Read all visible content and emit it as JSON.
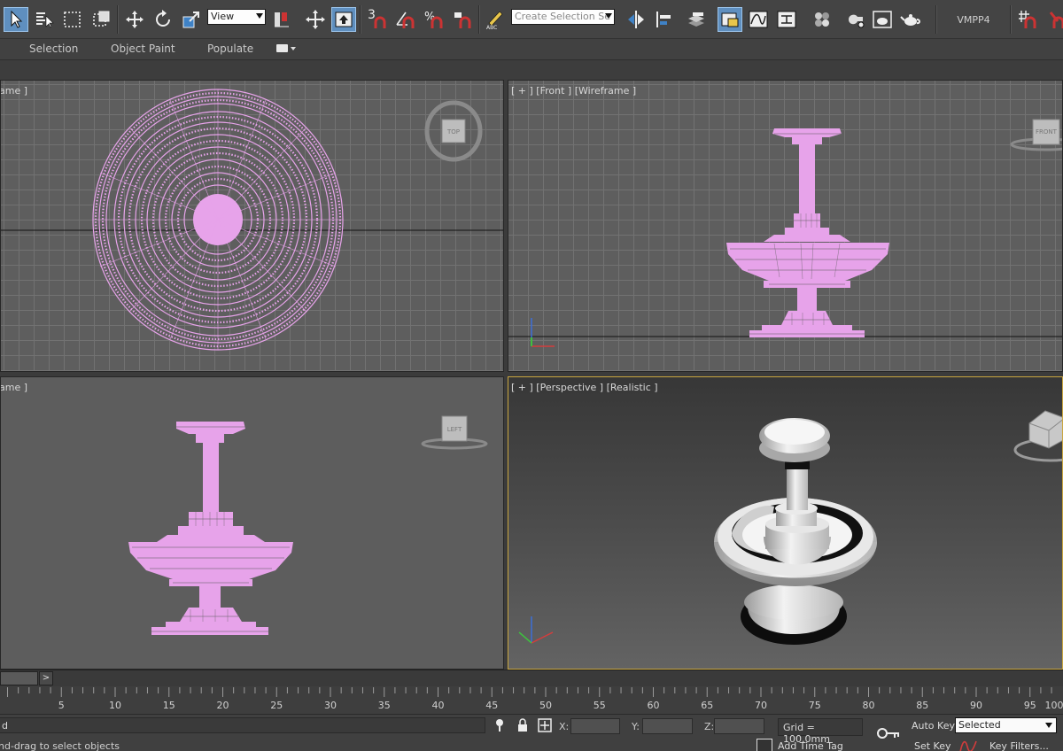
{
  "toolbar": {
    "reference_coord": "View",
    "named_selection": "Create Selection Se",
    "snap_3": "3",
    "workspace": "VMPP4"
  },
  "ribbon": {
    "tabs": [
      "Selection",
      "Object Paint",
      "Populate"
    ]
  },
  "viewports": {
    "top": {
      "label": "ame ]",
      "viewcube": "TOP"
    },
    "front": {
      "label": "[ + ] [Front ] [Wireframe ]",
      "viewcube": "FRONT"
    },
    "left": {
      "label": "ame ]",
      "viewcube": "LEFT"
    },
    "perspective": {
      "label": "[ + ] [Perspective ] [Realistic ]"
    }
  },
  "timeline": {
    "ticks": [
      "5",
      "10",
      "15",
      "20",
      "25",
      "30",
      "35",
      "40",
      "45",
      "50",
      "55",
      "60",
      "65",
      "70",
      "75",
      "80",
      "85",
      "90",
      "95",
      "100"
    ]
  },
  "status": {
    "selection_text": "d",
    "prompt": "nd-drag to select objects",
    "x_label": "X:",
    "y_label": "Y:",
    "z_label": "Z:",
    "x_value": "",
    "y_value": "",
    "z_value": "",
    "grid": "Grid = 100.0mm",
    "add_time_tag": "Add Time Tag",
    "auto_key": "Auto Key",
    "set_key": "Set Key",
    "key_mode": "Selected",
    "key_filters": "Key Filters..."
  },
  "colors": {
    "selected_wire": "#e7a3ea",
    "active_viewport_border": "#c9a640",
    "active_tool": "#5f8fbf"
  }
}
